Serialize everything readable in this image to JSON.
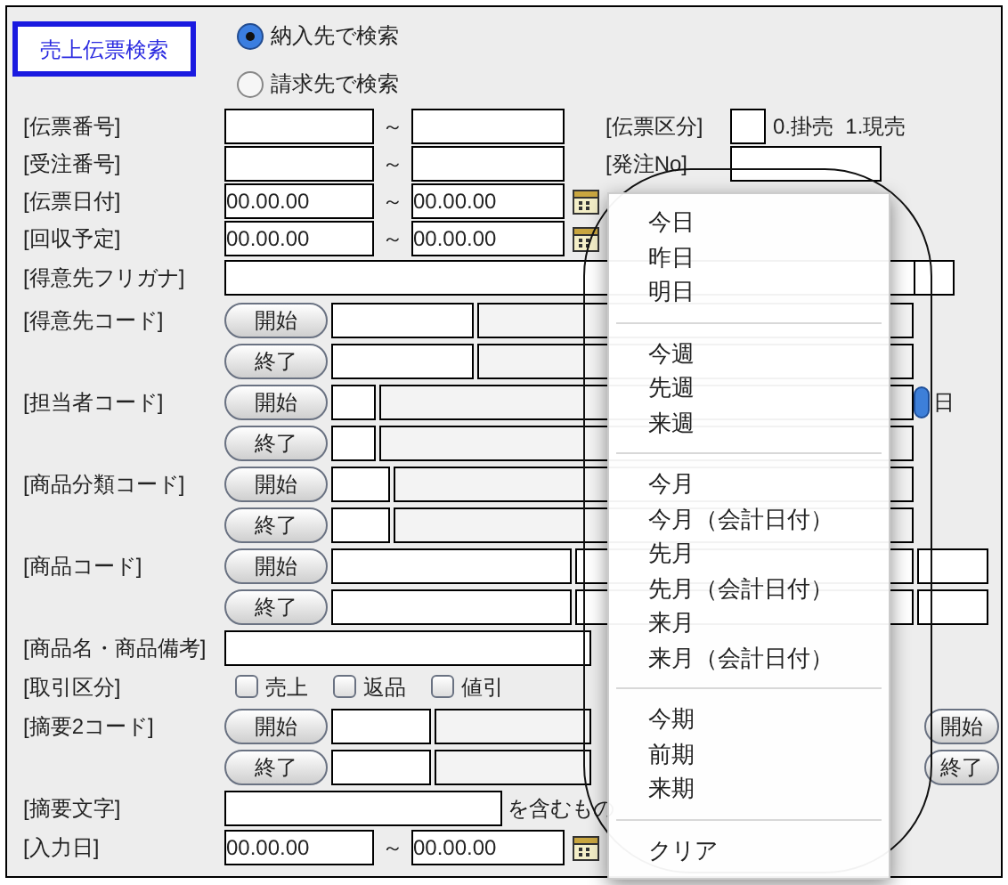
{
  "title": "売上伝票検索",
  "search_target": [
    {
      "label": "納入先で検索",
      "selected": true
    },
    {
      "label": "請求先で検索",
      "selected": false
    }
  ],
  "rows": [
    {
      "kind": "range",
      "label": "[伝票番号]",
      "side_label": "[伝票区分]",
      "side_hint": "0.掛売  1.現売",
      "tilde": "～"
    },
    {
      "kind": "range",
      "label": "[受注番号]",
      "side_label": "[発注No]",
      "tilde": "～"
    },
    {
      "kind": "date_range",
      "label": "[伝票日付]",
      "from": "00.00.00",
      "tilde": "～",
      "to": "00.00.00"
    },
    {
      "kind": "date_range",
      "label": "[回収予定]",
      "from": "00.00.00",
      "tilde": "～",
      "to": "00.00.00"
    },
    {
      "kind": "wide_text",
      "label": "[得意先フリガナ]"
    },
    {
      "kind": "code_range",
      "label": "[得意先コード]",
      "lines": [
        {
          "button": "開始"
        },
        {
          "button": "終了"
        }
      ]
    },
    {
      "kind": "code_range",
      "label": "[担当者コード]",
      "lines": [
        {
          "button": "開始",
          "trailing_text": "日"
        },
        {
          "button": "終了"
        }
      ]
    },
    {
      "kind": "code_range",
      "label": "[商品分類コード]",
      "lines": [
        {
          "button": "開始"
        },
        {
          "button": "終了"
        }
      ]
    },
    {
      "kind": "code_range",
      "label": "[商品コード]",
      "lines": [
        {
          "button": "開始"
        },
        {
          "button": "終了"
        }
      ]
    },
    {
      "kind": "text",
      "label": "[商品名・商品備考]"
    },
    {
      "kind": "checks",
      "label": "[取引区分]",
      "options": [
        {
          "label": "売上",
          "checked": false
        },
        {
          "label": "返品",
          "checked": false
        },
        {
          "label": "値引",
          "checked": false
        }
      ]
    },
    {
      "kind": "code_range",
      "label": "[摘要2コード]",
      "lines": [
        {
          "button": "開始",
          "trailing_button": "開始"
        },
        {
          "button": "終了",
          "trailing_button": "終了"
        }
      ]
    },
    {
      "kind": "text_suffix",
      "label": "[摘要文字]",
      "suffix": "を含むもの"
    },
    {
      "kind": "date_range",
      "label": "[入力日]",
      "from": "00.00.00",
      "tilde": "～",
      "to": "00.00.00"
    }
  ],
  "date_menu": [
    {
      "kind": "item",
      "label": "今日"
    },
    {
      "kind": "item",
      "label": "昨日"
    },
    {
      "kind": "item",
      "label": "明日"
    },
    {
      "kind": "separator"
    },
    {
      "kind": "item",
      "label": "今週"
    },
    {
      "kind": "item",
      "label": "先週"
    },
    {
      "kind": "item",
      "label": "来週"
    },
    {
      "kind": "separator"
    },
    {
      "kind": "item",
      "label": "今月"
    },
    {
      "kind": "item",
      "label": "今月（会計日付）"
    },
    {
      "kind": "item",
      "label": "先月"
    },
    {
      "kind": "item",
      "label": "先月（会計日付）"
    },
    {
      "kind": "item",
      "label": "来月"
    },
    {
      "kind": "item",
      "label": "来月（会計日付）"
    },
    {
      "kind": "separator"
    },
    {
      "kind": "item",
      "label": "今期"
    },
    {
      "kind": "item",
      "label": "前期"
    },
    {
      "kind": "item",
      "label": "来期"
    },
    {
      "kind": "separator"
    },
    {
      "kind": "item",
      "label": "クリア"
    }
  ]
}
